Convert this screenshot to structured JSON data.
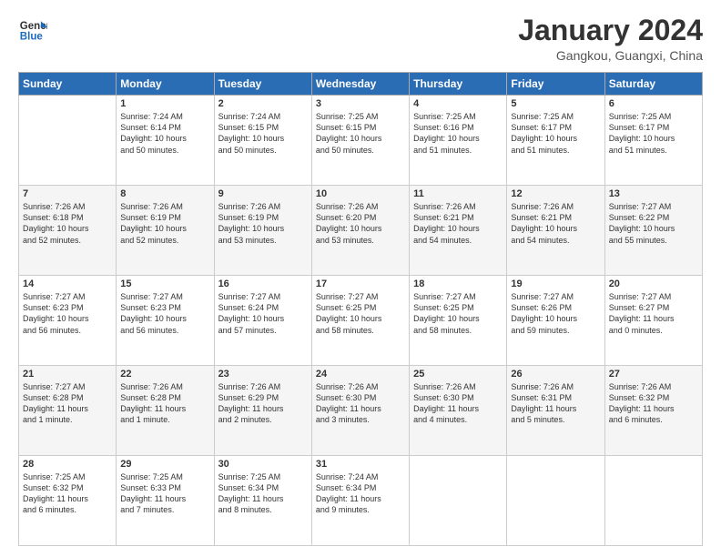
{
  "header": {
    "logo_line1": "General",
    "logo_line2": "Blue",
    "month": "January 2024",
    "location": "Gangkou, Guangxi, China"
  },
  "weekdays": [
    "Sunday",
    "Monday",
    "Tuesday",
    "Wednesday",
    "Thursday",
    "Friday",
    "Saturday"
  ],
  "weeks": [
    [
      {
        "day": null,
        "info": ""
      },
      {
        "day": "1",
        "info": "Sunrise: 7:24 AM\nSunset: 6:14 PM\nDaylight: 10 hours\nand 50 minutes."
      },
      {
        "day": "2",
        "info": "Sunrise: 7:24 AM\nSunset: 6:15 PM\nDaylight: 10 hours\nand 50 minutes."
      },
      {
        "day": "3",
        "info": "Sunrise: 7:25 AM\nSunset: 6:15 PM\nDaylight: 10 hours\nand 50 minutes."
      },
      {
        "day": "4",
        "info": "Sunrise: 7:25 AM\nSunset: 6:16 PM\nDaylight: 10 hours\nand 51 minutes."
      },
      {
        "day": "5",
        "info": "Sunrise: 7:25 AM\nSunset: 6:17 PM\nDaylight: 10 hours\nand 51 minutes."
      },
      {
        "day": "6",
        "info": "Sunrise: 7:25 AM\nSunset: 6:17 PM\nDaylight: 10 hours\nand 51 minutes."
      }
    ],
    [
      {
        "day": "7",
        "info": "Sunrise: 7:26 AM\nSunset: 6:18 PM\nDaylight: 10 hours\nand 52 minutes."
      },
      {
        "day": "8",
        "info": "Sunrise: 7:26 AM\nSunset: 6:19 PM\nDaylight: 10 hours\nand 52 minutes."
      },
      {
        "day": "9",
        "info": "Sunrise: 7:26 AM\nSunset: 6:19 PM\nDaylight: 10 hours\nand 53 minutes."
      },
      {
        "day": "10",
        "info": "Sunrise: 7:26 AM\nSunset: 6:20 PM\nDaylight: 10 hours\nand 53 minutes."
      },
      {
        "day": "11",
        "info": "Sunrise: 7:26 AM\nSunset: 6:21 PM\nDaylight: 10 hours\nand 54 minutes."
      },
      {
        "day": "12",
        "info": "Sunrise: 7:26 AM\nSunset: 6:21 PM\nDaylight: 10 hours\nand 54 minutes."
      },
      {
        "day": "13",
        "info": "Sunrise: 7:27 AM\nSunset: 6:22 PM\nDaylight: 10 hours\nand 55 minutes."
      }
    ],
    [
      {
        "day": "14",
        "info": "Sunrise: 7:27 AM\nSunset: 6:23 PM\nDaylight: 10 hours\nand 56 minutes."
      },
      {
        "day": "15",
        "info": "Sunrise: 7:27 AM\nSunset: 6:23 PM\nDaylight: 10 hours\nand 56 minutes."
      },
      {
        "day": "16",
        "info": "Sunrise: 7:27 AM\nSunset: 6:24 PM\nDaylight: 10 hours\nand 57 minutes."
      },
      {
        "day": "17",
        "info": "Sunrise: 7:27 AM\nSunset: 6:25 PM\nDaylight: 10 hours\nand 58 minutes."
      },
      {
        "day": "18",
        "info": "Sunrise: 7:27 AM\nSunset: 6:25 PM\nDaylight: 10 hours\nand 58 minutes."
      },
      {
        "day": "19",
        "info": "Sunrise: 7:27 AM\nSunset: 6:26 PM\nDaylight: 10 hours\nand 59 minutes."
      },
      {
        "day": "20",
        "info": "Sunrise: 7:27 AM\nSunset: 6:27 PM\nDaylight: 11 hours\nand 0 minutes."
      }
    ],
    [
      {
        "day": "21",
        "info": "Sunrise: 7:27 AM\nSunset: 6:28 PM\nDaylight: 11 hours\nand 1 minute."
      },
      {
        "day": "22",
        "info": "Sunrise: 7:26 AM\nSunset: 6:28 PM\nDaylight: 11 hours\nand 1 minute."
      },
      {
        "day": "23",
        "info": "Sunrise: 7:26 AM\nSunset: 6:29 PM\nDaylight: 11 hours\nand 2 minutes."
      },
      {
        "day": "24",
        "info": "Sunrise: 7:26 AM\nSunset: 6:30 PM\nDaylight: 11 hours\nand 3 minutes."
      },
      {
        "day": "25",
        "info": "Sunrise: 7:26 AM\nSunset: 6:30 PM\nDaylight: 11 hours\nand 4 minutes."
      },
      {
        "day": "26",
        "info": "Sunrise: 7:26 AM\nSunset: 6:31 PM\nDaylight: 11 hours\nand 5 minutes."
      },
      {
        "day": "27",
        "info": "Sunrise: 7:26 AM\nSunset: 6:32 PM\nDaylight: 11 hours\nand 6 minutes."
      }
    ],
    [
      {
        "day": "28",
        "info": "Sunrise: 7:25 AM\nSunset: 6:32 PM\nDaylight: 11 hours\nand 6 minutes."
      },
      {
        "day": "29",
        "info": "Sunrise: 7:25 AM\nSunset: 6:33 PM\nDaylight: 11 hours\nand 7 minutes."
      },
      {
        "day": "30",
        "info": "Sunrise: 7:25 AM\nSunset: 6:34 PM\nDaylight: 11 hours\nand 8 minutes."
      },
      {
        "day": "31",
        "info": "Sunrise: 7:24 AM\nSunset: 6:34 PM\nDaylight: 11 hours\nand 9 minutes."
      },
      {
        "day": null,
        "info": ""
      },
      {
        "day": null,
        "info": ""
      },
      {
        "day": null,
        "info": ""
      }
    ]
  ]
}
